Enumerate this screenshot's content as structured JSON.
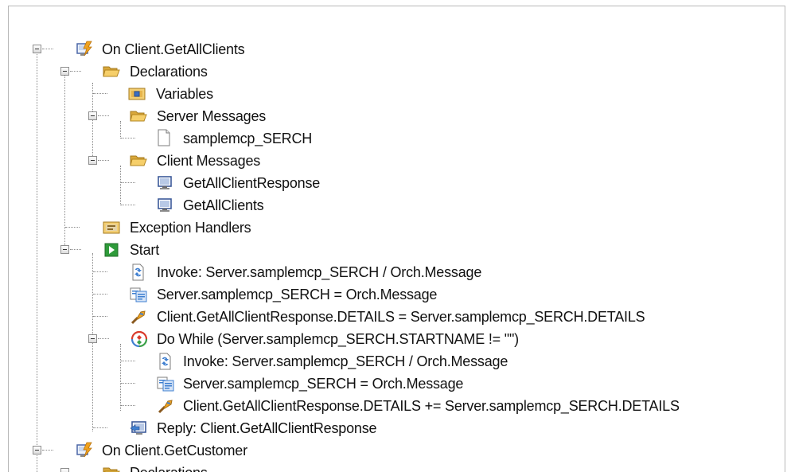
{
  "tree": {
    "nodes": [
      {
        "id": "on-client-getallclients",
        "label": "On Client.GetAllClients",
        "icon": "event-handler-icon",
        "expanded": true
      },
      {
        "id": "declarations",
        "label": "Declarations",
        "icon": "folder-open-icon",
        "expanded": true
      },
      {
        "id": "variables",
        "label": "Variables",
        "icon": "variables-icon"
      },
      {
        "id": "server-messages",
        "label": "Server Messages",
        "icon": "folder-open-icon",
        "expanded": true
      },
      {
        "id": "samplemcp-serch",
        "label": "samplemcp_SERCH",
        "icon": "document-icon"
      },
      {
        "id": "client-messages",
        "label": "Client Messages",
        "icon": "folder-open-icon",
        "expanded": true
      },
      {
        "id": "getallclientresponse",
        "label": "GetAllClientResponse",
        "icon": "client-message-icon"
      },
      {
        "id": "getallclients",
        "label": "GetAllClients",
        "icon": "client-message-icon"
      },
      {
        "id": "exception-handlers",
        "label": "Exception Handlers",
        "icon": "exception-handlers-icon"
      },
      {
        "id": "start",
        "label": "Start",
        "icon": "start-icon",
        "expanded": true
      },
      {
        "id": "invoke-1",
        "label": "Invoke: Server.samplemcp_SERCH / Orch.Message",
        "icon": "invoke-icon"
      },
      {
        "id": "assign-msg-1",
        "label": "Server.samplemcp_SERCH = Orch.Message",
        "icon": "assign-message-icon"
      },
      {
        "id": "assign-details-1",
        "label": "Client.GetAllClientResponse.DETAILS = Server.samplemcp_SERCH.DETAILS",
        "icon": "assign-field-icon"
      },
      {
        "id": "do-while",
        "label": "Do While (Server.samplemcp_SERCH.STARTNAME != \"\")",
        "icon": "loop-icon",
        "expanded": true
      },
      {
        "id": "invoke-2",
        "label": "Invoke: Server.samplemcp_SERCH / Orch.Message",
        "icon": "invoke-icon"
      },
      {
        "id": "assign-msg-2",
        "label": "Server.samplemcp_SERCH = Orch.Message",
        "icon": "assign-message-icon"
      },
      {
        "id": "assign-details-2",
        "label": "Client.GetAllClientResponse.DETAILS += Server.samplemcp_SERCH.DETAILS",
        "icon": "assign-field-icon"
      },
      {
        "id": "reply",
        "label": "Reply: Client.GetAllClientResponse",
        "icon": "reply-icon"
      },
      {
        "id": "on-client-getcustomer",
        "label": "On Client.GetCustomer",
        "icon": "event-handler-icon",
        "expanded": true
      },
      {
        "id": "declarations-2",
        "label": "Declarations",
        "icon": "folder-open-icon"
      }
    ]
  },
  "colors": {
    "folder": "#f3c85a",
    "folder_dark": "#c8962a",
    "event": "#e9a23b",
    "start_green": "#2e9b3a",
    "monitor_blue": "#3c5a99",
    "invoke_blue": "#3f7fd0",
    "loop_red": "#d93b2b",
    "loop_green": "#3aa048"
  }
}
